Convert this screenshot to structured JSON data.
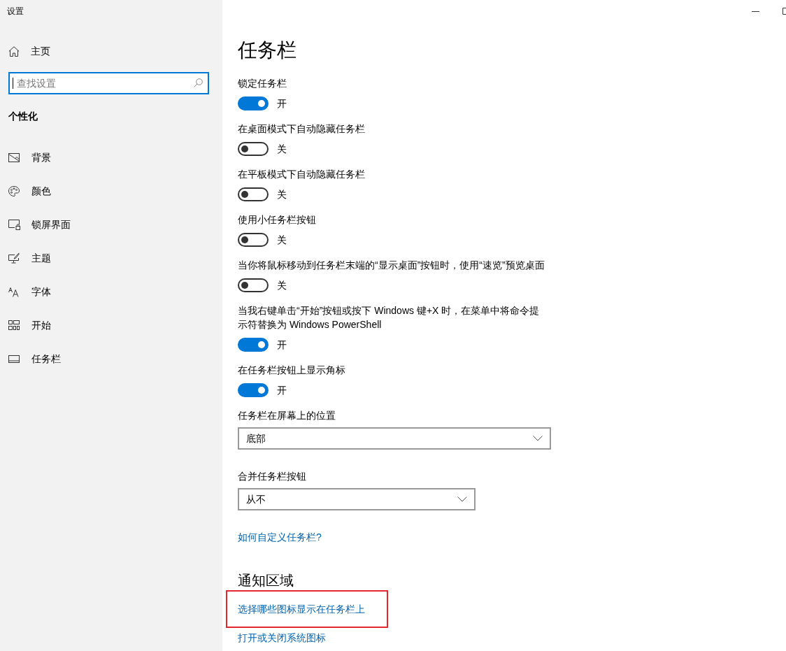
{
  "window": {
    "title": "设置"
  },
  "sidebar": {
    "home": {
      "label": "主页"
    },
    "search": {
      "placeholder": "查找设置",
      "focused": true
    },
    "section_title": "个性化",
    "items": [
      {
        "label": "背景"
      },
      {
        "label": "颜色"
      },
      {
        "label": "锁屏界面"
      },
      {
        "label": "主题"
      },
      {
        "label": "字体"
      },
      {
        "label": "开始"
      },
      {
        "label": "任务栏"
      }
    ]
  },
  "main": {
    "title": "任务栏",
    "settings": [
      {
        "kind": "toggle",
        "label": "锁定任务栏",
        "on": true,
        "state_label": "开"
      },
      {
        "kind": "toggle",
        "label": "在桌面模式下自动隐藏任务栏",
        "on": false,
        "state_label": "关"
      },
      {
        "kind": "toggle",
        "label": "在平板模式下自动隐藏任务栏",
        "on": false,
        "state_label": "关"
      },
      {
        "kind": "toggle",
        "label": "使用小任务栏按钮",
        "on": false,
        "state_label": "关"
      },
      {
        "kind": "toggle",
        "label": "当你将鼠标移动到任务栏末端的“显示桌面”按钮时，使用“速览”预览桌面",
        "on": false,
        "state_label": "关"
      },
      {
        "kind": "toggle",
        "label": "当我右键单击“开始”按钮或按下 Windows 键+X 时，在菜单中将命令提示符替换为 Windows PowerShell",
        "on": true,
        "state_label": "开"
      },
      {
        "kind": "toggle",
        "label": "在任务栏按钮上显示角标",
        "on": true,
        "state_label": "开"
      },
      {
        "kind": "dropdown",
        "label": "任务栏在屏幕上的位置",
        "value": "底部"
      },
      {
        "kind": "dropdown",
        "label": "合并任务栏按钮",
        "value": "从不"
      }
    ],
    "help_link": {
      "label": "如何自定义任务栏?"
    },
    "sections": [
      {
        "heading": "通知区域",
        "links": [
          {
            "label": "选择哪些图标显示在任务栏上",
            "highlighted": true
          },
          {
            "label": "打开或关闭系统图标",
            "highlighted": false
          }
        ]
      }
    ]
  }
}
